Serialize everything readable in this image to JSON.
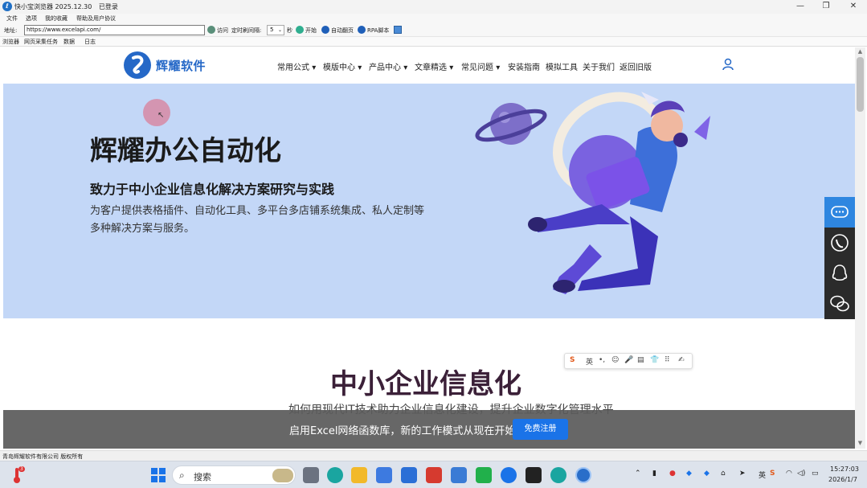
{
  "window": {
    "title": "快小宝浏览器 2025.12.30",
    "login_status": "已登录",
    "minimize": "—",
    "maximize": "❐",
    "close": "✕"
  },
  "menu": {
    "items": [
      "文件",
      "选项",
      "我的收藏",
      "帮助及用户协议"
    ]
  },
  "toolbar": {
    "address_label": "地址:",
    "address_value": "https://www.excelapi.com/",
    "visit_label": "访问",
    "interval_label": "定时刷间隔:",
    "interval_value": "5",
    "interval_unit": "秒",
    "start_label": "开始",
    "auto_page_label": "自动翻页",
    "rpa_label": "RPA脚本"
  },
  "tabs": [
    "浏览器",
    "网页采集任务",
    "数据",
    "日志"
  ],
  "site": {
    "logo_text": "辉耀软件",
    "nav": [
      "常用公式",
      "模版中心",
      "产品中心",
      "文章精选",
      "常见问题",
      "安装指南",
      "模拟工具",
      "关于我们",
      "返回旧版"
    ],
    "nav_dropdowns": [
      true,
      true,
      true,
      true,
      true,
      false,
      false,
      false,
      false
    ],
    "hero": {
      "title": "辉耀办公自动化",
      "subtitle": "致力于中小企业信息化解决方案研究与实践",
      "description": "为客户提供表格插件、自动化工具、多平台多店铺系统集成、私人定制等多种解决方案与服务。"
    },
    "section": {
      "title": "中小企业信息化",
      "subtitle": "如何用现代IT技术助力企业信息化建设，提升企业数字化管理水平"
    },
    "cta": {
      "text": "启用Excel网络函数库，新的工作模式从现在开始",
      "button": "免费注册"
    },
    "side_float": [
      "chat-icon",
      "phone-icon",
      "qq-icon",
      "wechat-icon"
    ]
  },
  "ime_toolbar": [
    "S",
    "英",
    "•,",
    "☺",
    "🎤",
    "▤",
    "👕",
    "⠿",
    "✍"
  ],
  "statusbar": {
    "text": "青岛辉耀软件有限公司 版权所有"
  },
  "taskbar": {
    "search_placeholder": "搜索",
    "temp_badge": "3",
    "tray_lang": "英",
    "time": "15:27:03",
    "date": "2026/1/7"
  }
}
